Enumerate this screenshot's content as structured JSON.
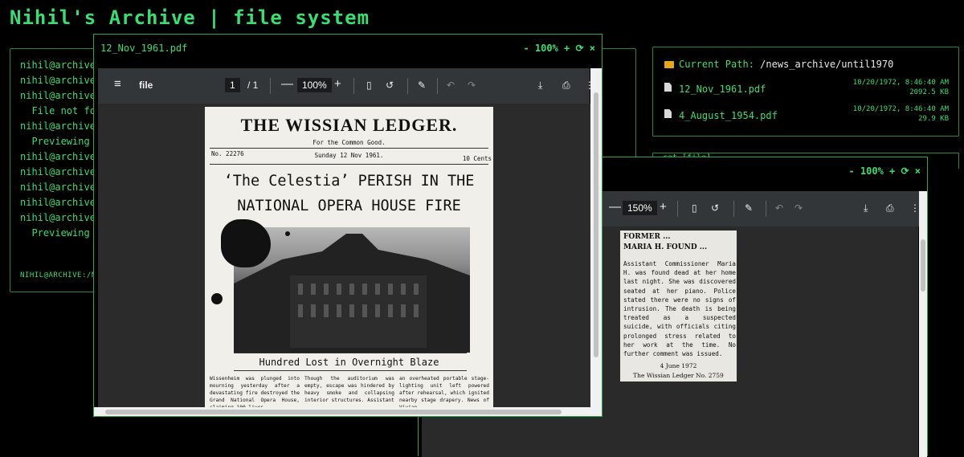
{
  "app_title": "Nihil's Archive | file system",
  "terminal": {
    "lines": [
      "nihil@archive",
      "nihil@archive",
      "nihil@archive",
      "  File not fo",
      "nihil@archive",
      "  Previewing",
      "nihil@archive",
      "nihil@archive",
      "nihil@archive",
      "nihil@archive",
      "nihil@archive",
      "  Previewing"
    ],
    "prompt": "NIHIL@ARCHIVE:/NE"
  },
  "explorer": {
    "path_label": "Current Path:",
    "path_value": "/news_archive/until1970",
    "files": [
      {
        "name": "12_Nov_1961.pdf",
        "date": "10/20/1972, 8:46:40 AM",
        "size": "2092.5 KB"
      },
      {
        "name": "4_August_1954.pdf",
        "date": "10/20/1972, 8:46:40 AM",
        "size": "29.9 KB"
      }
    ]
  },
  "cat_label": "cat [file]",
  "viewer_main": {
    "title": "12_Nov_1961.pdf",
    "controls": "- 100% + ⟳ ×",
    "toolbar": {
      "doc_name": "file",
      "page_current": "1",
      "page_total": "/ 1",
      "zoom": "100%"
    },
    "newspaper": {
      "masthead": "THE WISSIAN LEDGER.",
      "tagline": "For the Common Good.",
      "issue_no": "No. 22276",
      "date": "Sunday 12 Nov 1961.",
      "price": "10 Cents",
      "headline_1": "‘The Celestia’ PERISH IN THE",
      "headline_2": "NATIONAL OPERA HOUSE FIRE",
      "subhead": "Hundred Lost in Overnight Blaze",
      "col1": "Wissenheim was plunged into mourning yesterday after a devastating fire destroyed the Grand National Opera House, claiming 100 lives.",
      "col2": "Though the auditorium was empty, escape was hindered by heavy smoke and collapsing interior structures. Assistant",
      "col3": "an overheated portable stage-lighting unit left powered after rehearsal, which ignited nearby stage drapery. News of Vivian"
    }
  },
  "viewer_second": {
    "controls": "- 100% + ⟳ ×",
    "toolbar": {
      "zoom": "150%"
    },
    "clipping": {
      "heading_1": "FORMER ...",
      "heading_2": "MARIA H. FOUND ...",
      "body": "Assistant Commissioner Maria H. was found dead at her home last night. She was discovered seated at her piano. Police stated there were no signs of intrusion. The death is being treated as a suspected suicide, with officials citing prolonged stress related to her work at the time. No further comment was issued.",
      "date": "4 June 1972",
      "source": "The Wissian Ledger No. 2759"
    }
  },
  "colors": {
    "terminal_green": "#3ddc72",
    "border_green": "#1f8a3c",
    "pdf_toolbar": "#323639",
    "pdf_bg": "#525659",
    "paper": "#f1efe9"
  }
}
